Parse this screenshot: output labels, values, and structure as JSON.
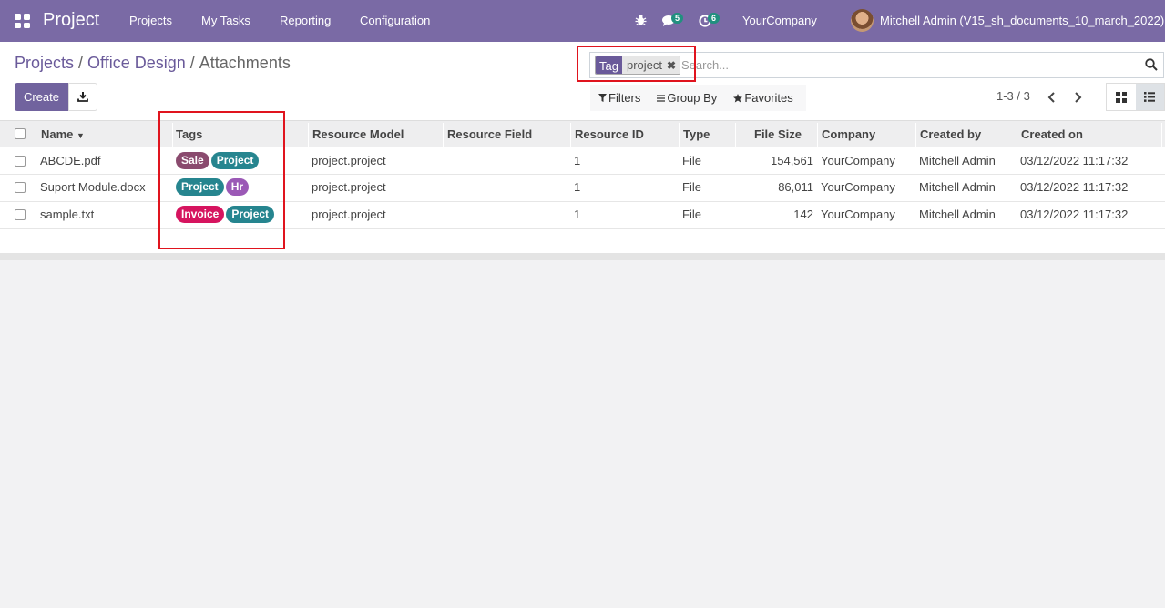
{
  "navbar": {
    "app_title": "Project",
    "menu": [
      "Projects",
      "My Tasks",
      "Reporting",
      "Configuration"
    ],
    "messages_count": "5",
    "activities_count": "6",
    "company": "YourCompany",
    "user": "Mitchell Admin (V15_sh_documents_10_march_2022)"
  },
  "breadcrumb": [
    "Projects",
    "Office Design",
    "Attachments"
  ],
  "buttons": {
    "create": "Create"
  },
  "search": {
    "facet_type": "Tag",
    "facet_value": "project",
    "placeholder": "Search..."
  },
  "filters": {
    "filters": "Filters",
    "group_by": "Group By",
    "favorites": "Favorites"
  },
  "pager": "1-3 / 3",
  "columns": [
    "Name",
    "Tags",
    "Resource Model",
    "Resource Field",
    "Resource ID",
    "Type",
    "File Size",
    "Company",
    "Created by",
    "Created on"
  ],
  "rows": [
    {
      "name": "ABCDE.pdf",
      "tags": [
        {
          "label": "Sale",
          "color": "#8a4a6e"
        },
        {
          "label": "Project",
          "color": "#26858f"
        }
      ],
      "resource_model": "project.project",
      "resource_field": "",
      "resource_id": "1",
      "type": "File",
      "file_size": "154,561",
      "company": "YourCompany",
      "created_by": "Mitchell Admin",
      "created_on": "03/12/2022 11:17:32"
    },
    {
      "name": "Suport Module.docx",
      "tags": [
        {
          "label": "Project",
          "color": "#26858f"
        },
        {
          "label": "Hr",
          "color": "#9b59b6"
        }
      ],
      "resource_model": "project.project",
      "resource_field": "",
      "resource_id": "1",
      "type": "File",
      "file_size": "86,011",
      "company": "YourCompany",
      "created_by": "Mitchell Admin",
      "created_on": "03/12/2022 11:17:32"
    },
    {
      "name": "sample.txt",
      "tags": [
        {
          "label": "Invoice",
          "color": "#d6145f"
        },
        {
          "label": "Project",
          "color": "#26858f"
        }
      ],
      "resource_model": "project.project",
      "resource_field": "",
      "resource_id": "1",
      "type": "File",
      "file_size": "142",
      "company": "YourCompany",
      "created_by": "Mitchell Admin",
      "created_on": "03/12/2022 11:17:32"
    }
  ],
  "colors": {
    "navbar": "#7a6aa5",
    "primary": "#71639e",
    "highlight": "#e0141e"
  }
}
